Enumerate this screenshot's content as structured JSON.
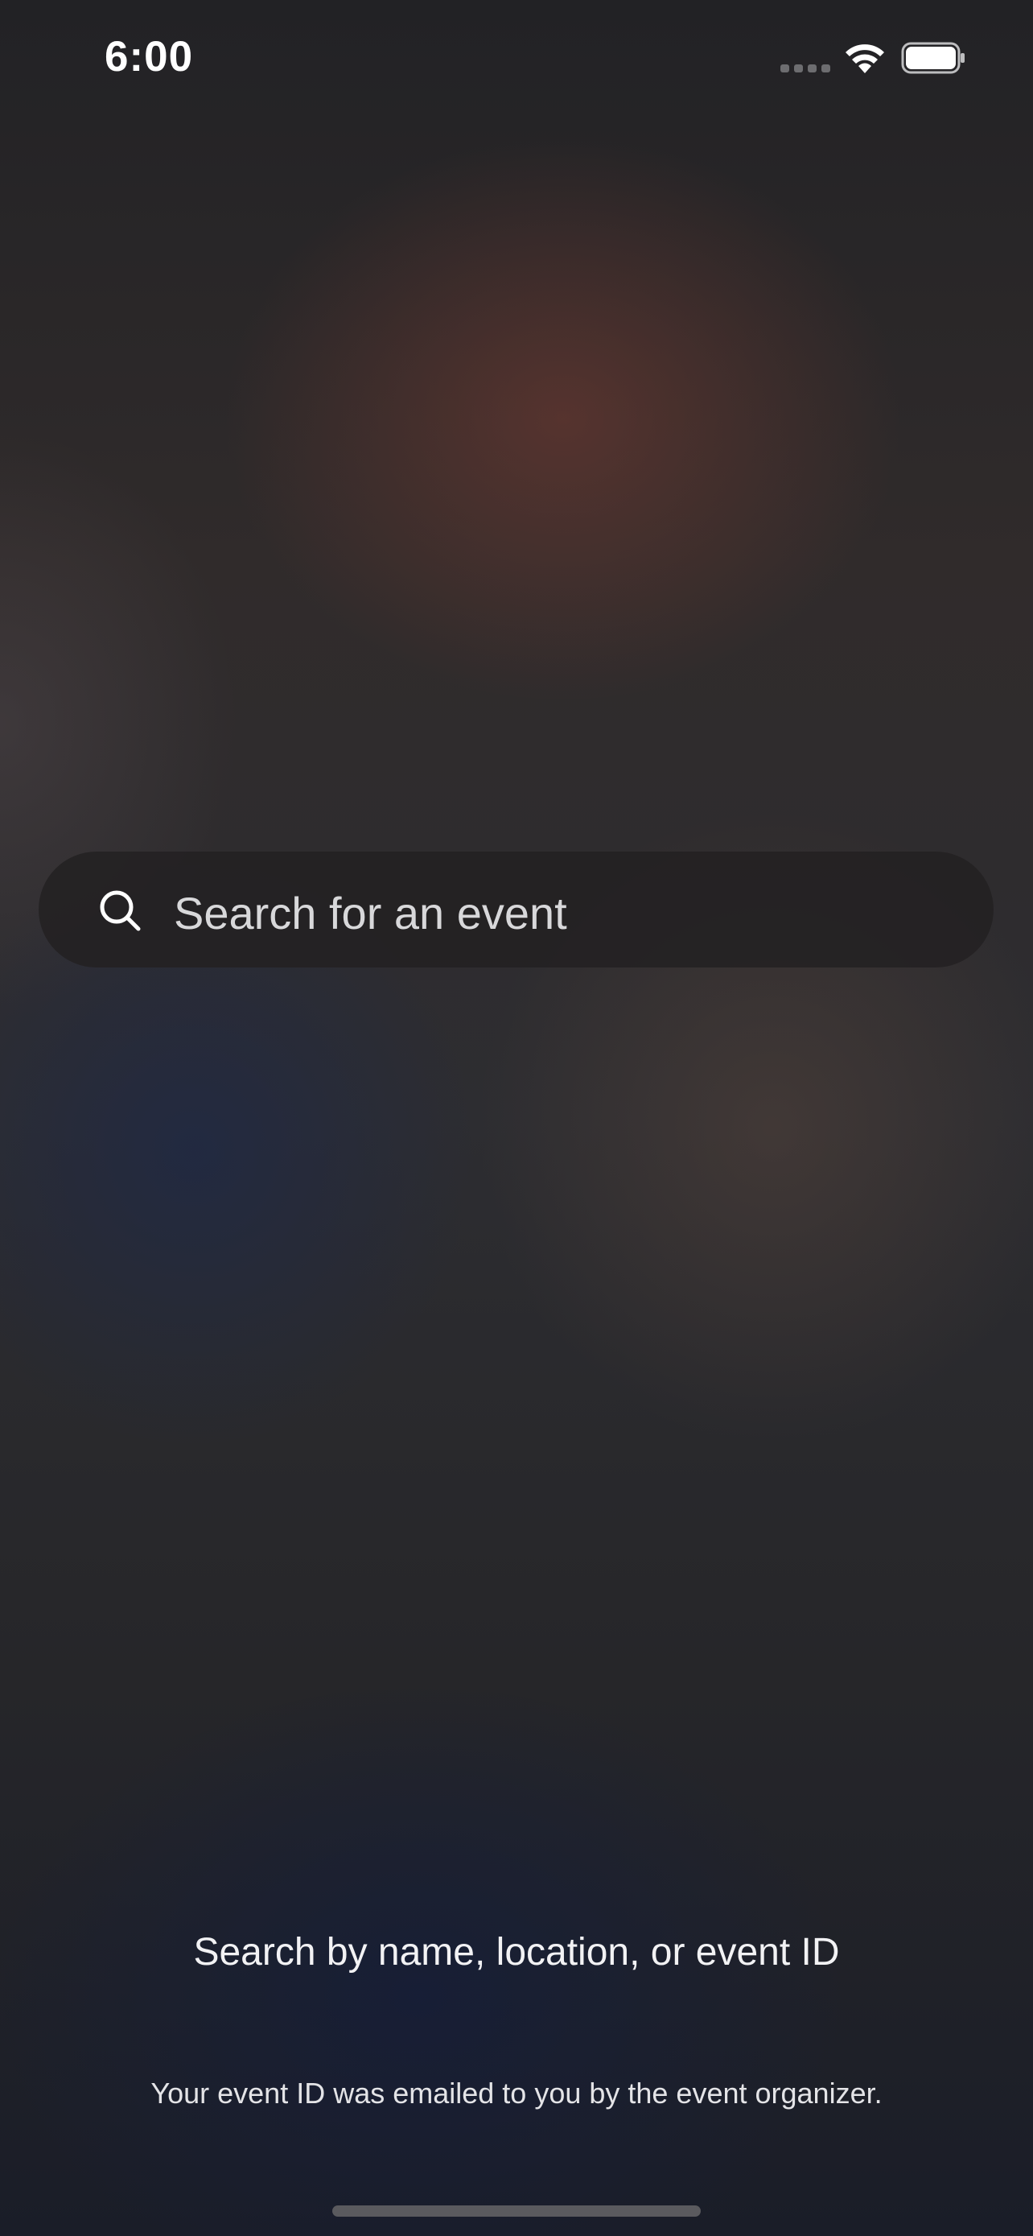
{
  "status_bar": {
    "time": "6:00",
    "icons": [
      "signal-icon",
      "wifi-icon",
      "battery-icon"
    ]
  },
  "search": {
    "placeholder": "Search for an event",
    "icon": "search-icon"
  },
  "help": {
    "title": "Search by name, location, or event ID",
    "subtitle": "Your event ID was emailed to you by the event organizer."
  },
  "colors": {
    "background": "#2a2a2c",
    "search_bar": "#232122",
    "text_primary": "#ffffff",
    "text_secondary": "#d8d8da"
  }
}
